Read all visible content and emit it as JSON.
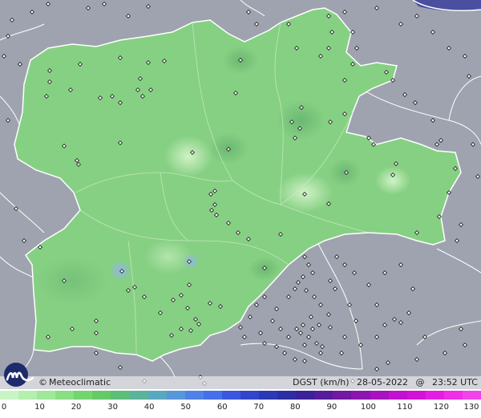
{
  "map": {
    "brand": "Meteoclimatic",
    "brand_copyright": "©",
    "variable": "DGST (km/h)",
    "date": "28-05-2022",
    "at": "@",
    "time": "23:52 UTC",
    "region_color": "#86d083",
    "outside_color": "#9ea3af",
    "border_color": "#ffffff",
    "station_marker": "diamond-icon"
  },
  "scale": {
    "ticks": [
      "0",
      "10",
      "20",
      "30",
      "40",
      "50",
      "60",
      "70",
      "80",
      "90",
      "100",
      "110",
      "120",
      "130"
    ],
    "colors": [
      "#c8f5c5",
      "#b4efb0",
      "#9fe89a",
      "#89df84",
      "#74d46f",
      "#64c966",
      "#5cbe78",
      "#5bb39a",
      "#5aa7c0",
      "#5796db",
      "#5082e6",
      "#4670e9",
      "#3b57dd",
      "#3146c9",
      "#2b39b5",
      "#2e2ea3",
      "#3b229a",
      "#561c9c",
      "#7218a3",
      "#8c15b0",
      "#a613bf",
      "#c012cf",
      "#d312d8",
      "#e41ee0",
      "#ee2fe6",
      "#f243ea"
    ]
  }
}
